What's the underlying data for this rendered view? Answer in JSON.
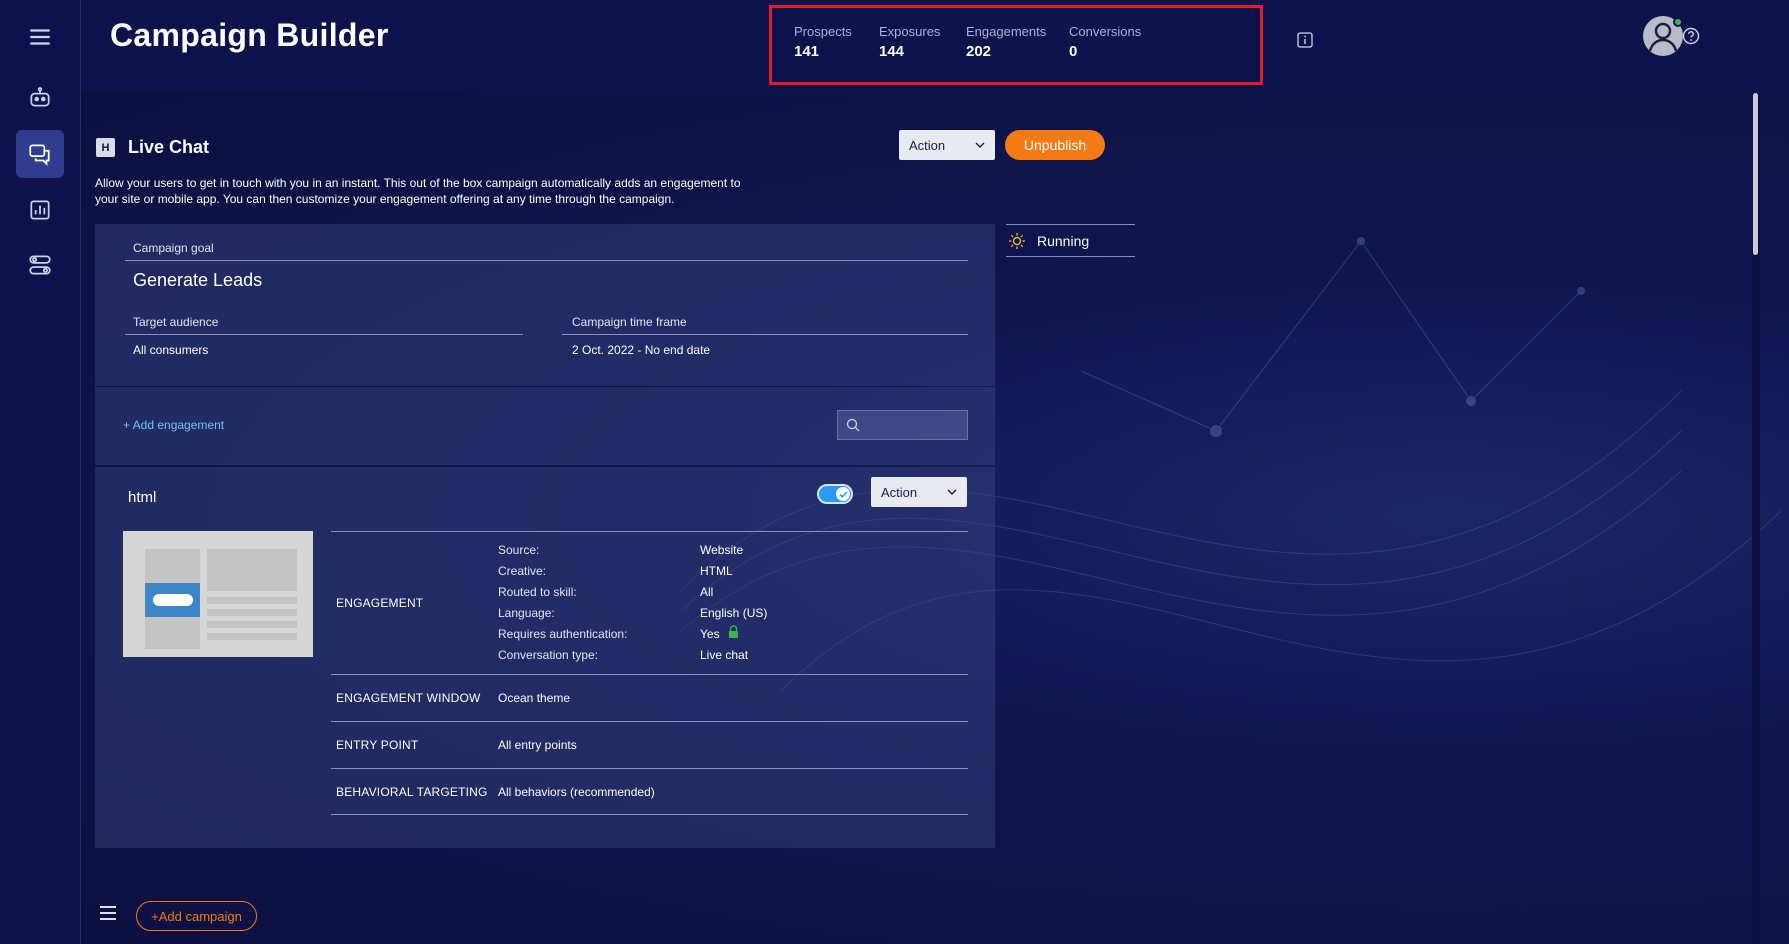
{
  "header": {
    "title": "Campaign Builder",
    "kpis": [
      {
        "label": "Prospects",
        "value": "141"
      },
      {
        "label": "Exposures",
        "value": "144"
      },
      {
        "label": "Engagements",
        "value": "202"
      },
      {
        "label": "Conversions",
        "value": "0"
      }
    ]
  },
  "campaign": {
    "icon_letter": "H",
    "name": "Live Chat",
    "action_label": "Action",
    "unpublish_label": "Unpublish",
    "description": "Allow your users to get in touch with you in an instant. This out of the box campaign automatically adds an engagement to your site or mobile app. You can then customize your engagement offering at any time through the campaign.",
    "status": "Running",
    "goal_label": "Campaign goal",
    "goal_value": "Generate Leads",
    "audience_label": "Target audience",
    "audience_value": "All consumers",
    "timeframe_label": "Campaign time frame",
    "timeframe_value": "2 Oct. 2022 - No end date"
  },
  "engagements": {
    "add_label": "+  Add engagement",
    "search_placeholder": "",
    "item": {
      "name": "html",
      "action_label": "Action",
      "toggle_on": true,
      "details_label": "ENGAGEMENT",
      "details": [
        {
          "key": "Source:",
          "value": "Website"
        },
        {
          "key": "Creative:",
          "value": "HTML"
        },
        {
          "key": "Routed to skill:",
          "value": "All"
        },
        {
          "key": "Language:",
          "value": "English (US)"
        },
        {
          "key": "Requires authentication:",
          "value": "Yes"
        },
        {
          "key": "Conversation type:",
          "value": "Live chat"
        }
      ],
      "window_label": "ENGAGEMENT WINDOW",
      "window_value": "Ocean theme",
      "entry_label": "ENTRY POINT",
      "entry_value": "All entry points",
      "behavior_label": "BEHAVIORAL TARGETING",
      "behavior_value": "All behaviors (recommended)"
    }
  },
  "footer": {
    "add_campaign_label": "+Add campaign"
  },
  "colors": {
    "accent": "#f47a16",
    "highlight": "#e31b2d",
    "link": "#6fc1ff",
    "status_ok": "#3cb44b"
  }
}
